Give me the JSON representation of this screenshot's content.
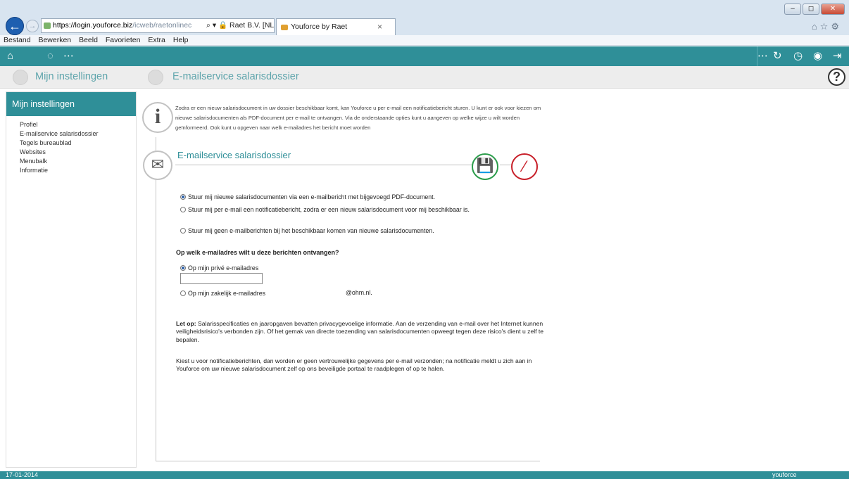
{
  "browser": {
    "url_host": "https://login.youforce.biz",
    "url_path": "/icweb/raetonlinec",
    "cert_label": "Raet B.V. [NL]",
    "tab_title": "Youforce by Raet",
    "tab_close": "×",
    "chrome_icons": "⌂☆⚙",
    "window_buttons": [
      "–",
      "◻",
      "✕"
    ],
    "menu": [
      "Bestand",
      "Bewerken",
      "Beeld",
      "Favorieten",
      "Extra",
      "Help"
    ]
  },
  "toolbar": {
    "icons": [
      "home-icon",
      "spinner-icon",
      "more-icon",
      "more-icon",
      "refresh-icon",
      "history-icon",
      "user-icon",
      "logout-icon"
    ]
  },
  "breadcrumb": {
    "left_title": "Mijn instellingen",
    "page_title": "E-mailservice salarisdossier",
    "help_label": "?"
  },
  "sidebar": {
    "header": "Mijn instellingen",
    "items": [
      {
        "label": "Profiel"
      },
      {
        "label": "E-mailservice salarisdossier"
      },
      {
        "label": "Tegels bureaublad"
      },
      {
        "label": "Websites"
      },
      {
        "label": "Menubalk"
      },
      {
        "label": "Informatie"
      }
    ]
  },
  "main": {
    "info_text": "Zodra er een nieuw salarisdocument in uw dossier beschikbaar komt, kan Youforce u per e-mail een notificatiebericht sturen. U kunt er ook voor kiezen om nieuwe salarisdocumenten als PDF-document per e-mail te ontvangen. Via de onderstaande opties kunt u aangeven op welke wijze u wilt worden geïnformeerd. Ook kunt u opgeven naar welk e-mailadres het bericht moet worden",
    "section_title": "E-mailservice salarisdossier",
    "options": [
      {
        "label": "Stuur mij nieuwe salarisdocumenten via een e-mailbericht met bijgevoegd PDF-document.",
        "selected": true
      },
      {
        "label": "Stuur mij per e-mail een notificatiebericht, zodra er een nieuw salarisdocument voor mij beschikbaar is.",
        "selected": false
      },
      {
        "label": "Stuur mij geen e-mailberichten bij het beschikbaar komen van nieuwe salarisdocumenten.",
        "selected": false
      }
    ],
    "question": "Op welk e-mailadres wilt u deze berichten ontvangen?",
    "address_options": [
      {
        "label": "Op mijn privé e-mailadres",
        "selected": true
      },
      {
        "label": "Op mijn zakelijk e-mailadres",
        "selected": false
      }
    ],
    "private_email_value": "",
    "business_domain": "@ohm.nl.",
    "note_prefix": "Let op:",
    "note_1": "Salarisspecificaties en jaaropgaven bevatten privacygevoelige informatie. Aan de verzending van e-mail over het Internet kunnen veiligheidsrisico's verbonden zijn. Of het gemak van directe toezending van salarisdocumenten opweegt tegen deze risico's dient u zelf te bepalen.",
    "note_2": "Kiest u voor notificatieberichten, dan worden er geen vertrouwelijke gegevens per e-mail verzonden; na notificatie meldt u zich aan in Youforce om uw nieuwe salarisdocument zelf op ons beveiligde portaal te raadplegen of op te halen."
  },
  "footer": {
    "date": "17-01-2014",
    "brand": "youforce"
  },
  "colors": {
    "teal": "#2f8f98",
    "save_green": "#2a9c4a",
    "cancel_red": "#c8202a"
  }
}
